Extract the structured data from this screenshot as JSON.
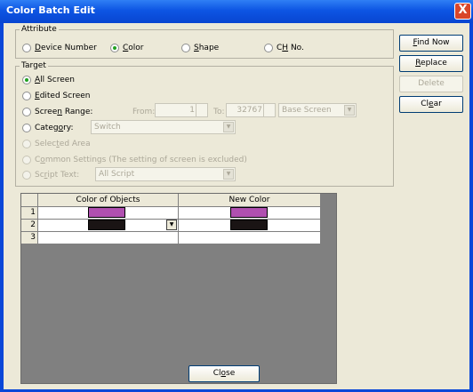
{
  "window": {
    "title": "Color Batch Edit",
    "close_glyph": "X"
  },
  "attribute": {
    "legend": "Attribute",
    "options": [
      {
        "pre": "",
        "accel": "D",
        "post": "evice Number",
        "selected": false
      },
      {
        "pre": "",
        "accel": "C",
        "post": "olor",
        "selected": true
      },
      {
        "pre": "",
        "accel": "S",
        "post": "hape",
        "selected": false
      },
      {
        "pre": "C",
        "accel": "H",
        "post": " No.",
        "selected": false
      }
    ]
  },
  "target": {
    "legend": "Target",
    "all_screen": {
      "pre": "",
      "accel": "A",
      "post": "ll Screen"
    },
    "edited_screen": {
      "pre": "",
      "accel": "E",
      "post": "dited Screen"
    },
    "screen_range": {
      "pre": "Scree",
      "accel": "n",
      "post": " Range:",
      "from_label": "From:",
      "from_value": "1",
      "to_label": "To:",
      "to_value": "32767",
      "screen_type": "Base Screen"
    },
    "category": {
      "pre": "Categ",
      "accel": "o",
      "post": "ry:",
      "value": "Switch"
    },
    "selected_area": {
      "pre": "Selec",
      "accel": "t",
      "post": "ed Area"
    },
    "common_settings": {
      "pre": "C",
      "accel": "o",
      "post": "mmon Settings (The setting of screen is excluded)"
    },
    "script_text": {
      "pre": "Sc",
      "accel": "r",
      "post": "ipt Text:",
      "value": "All Script"
    }
  },
  "buttons": {
    "find_now": {
      "pre": "",
      "accel": "F",
      "post": "ind Now"
    },
    "replace": {
      "pre": "",
      "accel": "R",
      "post": "eplace"
    },
    "delete": {
      "label": "Delete"
    },
    "clear": {
      "pre": "Cl",
      "accel": "e",
      "post": "ar"
    },
    "close": {
      "pre": "Cl",
      "accel": "o",
      "post": "se"
    }
  },
  "table": {
    "columns": [
      "Color of Objects",
      "New Color"
    ],
    "rows": [
      {
        "num": "1",
        "object_color": "#b050b0",
        "new_color": "#b050b0"
      },
      {
        "num": "2",
        "object_color": "#1a1414",
        "new_color": "#1a1414"
      },
      {
        "num": "3",
        "object_color": "",
        "new_color": ""
      }
    ]
  }
}
